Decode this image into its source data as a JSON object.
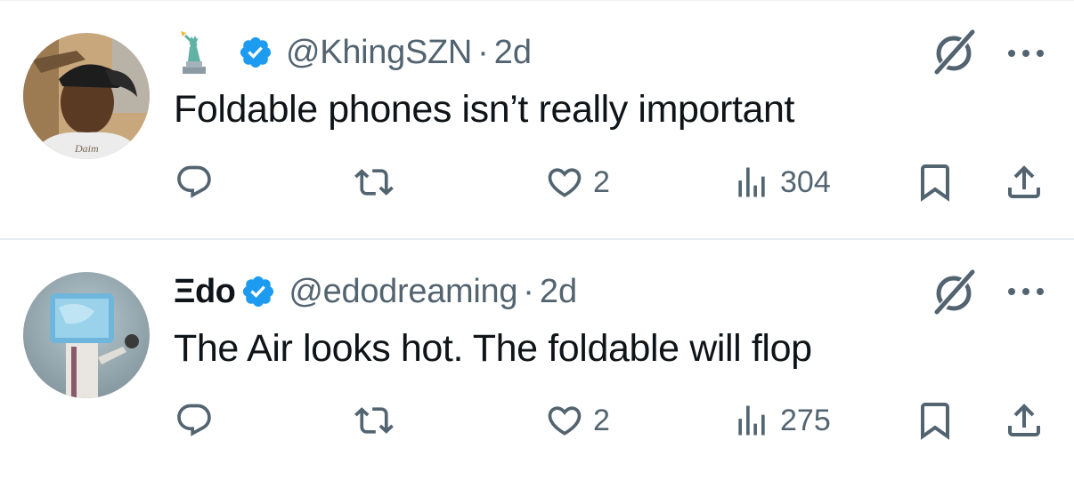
{
  "tweets": [
    {
      "display_name_emoji": "statue-of-liberty-icon",
      "verified": true,
      "handle": "@KhingSZN",
      "separator": "·",
      "time": "2d",
      "text": "Foldable phones isn’t really important",
      "reply_count": "",
      "retweet_count": "",
      "like_count": "2",
      "view_count": "304"
    },
    {
      "display_name": "Ξdo",
      "verified": true,
      "handle": "@edodreaming",
      "separator": "·",
      "time": "2d",
      "text": "The Air looks hot. The foldable will flop",
      "reply_count": "",
      "retweet_count": "",
      "like_count": "2",
      "view_count": "275"
    }
  ],
  "colors": {
    "text_primary": "#0f1419",
    "text_secondary": "#536471",
    "verified_badge": "#1d9bf0",
    "divider": "#e6ecf0",
    "background": "#ffffff"
  }
}
